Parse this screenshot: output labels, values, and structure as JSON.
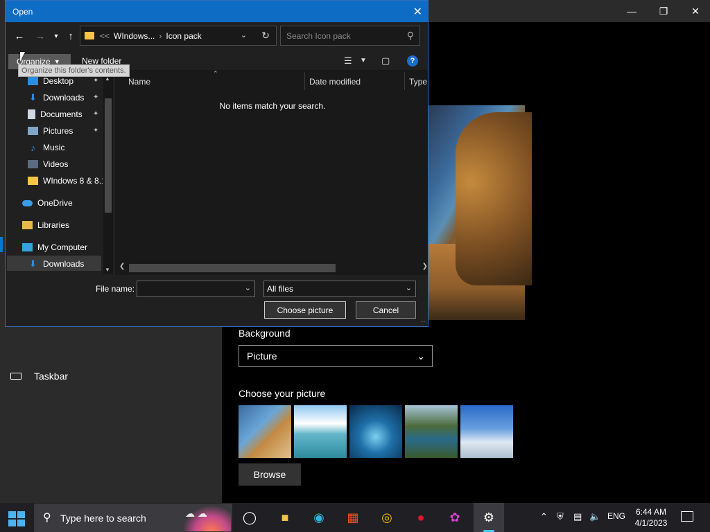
{
  "dialog": {
    "title": "Open",
    "breadcrumb": {
      "prefix": "<<",
      "parent": "WIndows...",
      "current": "Icon pack"
    },
    "search_placeholder": "Search Icon pack",
    "toolbar": {
      "organize_label": "Organize",
      "new_folder_label": "New folder"
    },
    "tooltip": "Organize this folder's contents.",
    "nav_items": [
      {
        "label": "Desktop",
        "icon": "desktop-icon",
        "pinned": true
      },
      {
        "label": "Downloads",
        "icon": "download-icon",
        "pinned": true
      },
      {
        "label": "Documents",
        "icon": "documents-icon",
        "pinned": true
      },
      {
        "label": "Pictures",
        "icon": "pictures-icon",
        "pinned": true
      },
      {
        "label": "Music",
        "icon": "music-icon",
        "pinned": false
      },
      {
        "label": "Videos",
        "icon": "videos-icon",
        "pinned": false
      },
      {
        "label": "WIndows 8 & 8.1",
        "icon": "folder-icon",
        "pinned": false
      },
      {
        "label": "OneDrive",
        "icon": "onedrive-icon",
        "pinned": false
      },
      {
        "label": "Libraries",
        "icon": "libraries-icon",
        "pinned": false
      },
      {
        "label": "My Computer",
        "icon": "computer-icon",
        "pinned": false
      },
      {
        "label": "Downloads",
        "icon": "download-icon",
        "pinned": false,
        "selected": true
      }
    ],
    "columns": [
      "Name",
      "Date modified",
      "Type"
    ],
    "empty_message": "No items match your search.",
    "file_name_label": "File name:",
    "file_name_value": "",
    "file_type": "All files",
    "choose_button": "Choose picture",
    "cancel_button": "Cancel"
  },
  "settings": {
    "nav_taskbar": "Taskbar",
    "background_label": "Background",
    "background_value": "Picture",
    "choose_picture_label": "Choose your picture",
    "browse_label": "Browse"
  },
  "taskbar": {
    "search_placeholder": "Type here to search",
    "language": "ENG",
    "time": "6:44 AM",
    "date": "4/1/2023"
  },
  "colors": {
    "titlebar": "#0f6cc4",
    "accent": "#0078d4",
    "dialog_bg": "#202020",
    "taskbar_bg": "#1f1f24"
  }
}
